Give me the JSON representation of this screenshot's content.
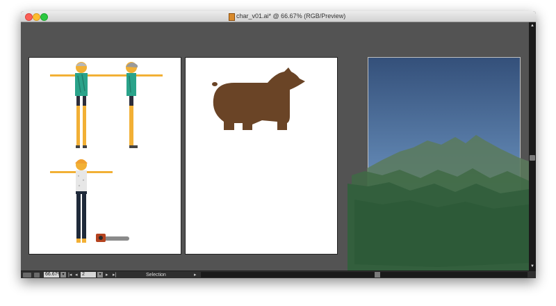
{
  "window": {
    "title": "char_v01.ai* @ 66.67% (RGB/Preview)"
  },
  "statusbar": {
    "zoom": "66.67%",
    "page": "2",
    "tool": "Selection"
  },
  "icons": {
    "close": "close-button",
    "minimize": "minimize-button",
    "zoom_window": "zoom-window-button",
    "document": "document-icon",
    "chainsaw": "chainsaw-illustration",
    "bear": "bear-illustration"
  },
  "colors": {
    "pasteboard": "#535353",
    "skin": "#f2b035",
    "shirt": "#2aa38a",
    "bear": "#6a4426",
    "mountain_dark": "#2d5a38",
    "sky_top": "#34507a"
  }
}
